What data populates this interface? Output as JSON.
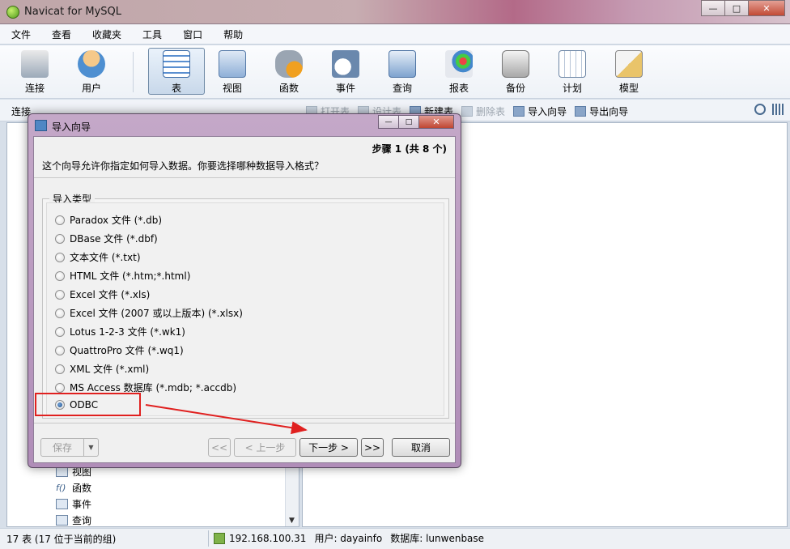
{
  "app": {
    "title": "Navicat for MySQL"
  },
  "window_controls": {
    "minimize": "—",
    "maximize": "□",
    "close": "✕"
  },
  "menu": [
    "文件",
    "查看",
    "收藏夹",
    "工具",
    "窗口",
    "帮助"
  ],
  "toolbar": [
    {
      "label": "连接",
      "icon": "connection-icon"
    },
    {
      "label": "用户",
      "icon": "user-icon"
    },
    {
      "label": "表",
      "icon": "table-icon"
    },
    {
      "label": "视图",
      "icon": "view-icon"
    },
    {
      "label": "函数",
      "icon": "function-icon"
    },
    {
      "label": "事件",
      "icon": "event-icon"
    },
    {
      "label": "查询",
      "icon": "query-icon"
    },
    {
      "label": "报表",
      "icon": "report-icon"
    },
    {
      "label": "备份",
      "icon": "backup-icon"
    },
    {
      "label": "计划",
      "icon": "schedule-icon"
    },
    {
      "label": "模型",
      "icon": "model-icon"
    }
  ],
  "subbar": {
    "conn_label": "连接",
    "actions": [
      {
        "label": "打开表",
        "disabled": true
      },
      {
        "label": "设计表",
        "disabled": true
      },
      {
        "label": "新建表",
        "disabled": false
      },
      {
        "label": "删除表",
        "disabled": true
      },
      {
        "label": "导入向导",
        "disabled": false
      },
      {
        "label": "导出向导",
        "disabled": false
      }
    ]
  },
  "tree": [
    {
      "label": "视图",
      "icon": "view-icon"
    },
    {
      "label": "函数",
      "icon": "function-icon"
    },
    {
      "label": "事件",
      "icon": "event-icon"
    },
    {
      "label": "查询",
      "icon": "query-icon"
    }
  ],
  "status": {
    "left": "17 表 (17 位于当前的组)",
    "host": "192.168.100.31",
    "user": "用户: dayainfo",
    "database": "数据库: lunwenbase"
  },
  "dialog": {
    "title": "导入向导",
    "step": "步骤 1 (共 8 个)",
    "description": "这个向导允许你指定如何导入数据。你要选择哪种数据导入格式？",
    "group_label": "导入类型",
    "options": [
      {
        "label": "Paradox 文件 (*.db)",
        "selected": false
      },
      {
        "label": "DBase 文件 (*.dbf)",
        "selected": false
      },
      {
        "label": "文本文件 (*.txt)",
        "selected": false
      },
      {
        "label": "HTML 文件 (*.htm;*.html)",
        "selected": false
      },
      {
        "label": "Excel 文件 (*.xls)",
        "selected": false
      },
      {
        "label": "Excel 文件 (2007 或以上版本) (*.xlsx)",
        "selected": false
      },
      {
        "label": "Lotus 1-2-3 文件 (*.wk1)",
        "selected": false
      },
      {
        "label": "QuattroPro 文件 (*.wq1)",
        "selected": false
      },
      {
        "label": "XML 文件 (*.xml)",
        "selected": false
      },
      {
        "label": "MS Access 数据库 (*.mdb; *.accdb)",
        "selected": false
      },
      {
        "label": "ODBC",
        "selected": true
      }
    ],
    "buttons": {
      "save": "保存",
      "first": "<<",
      "prev": "< 上一步",
      "next": "下一步 >",
      "last": ">>",
      "cancel": "取消"
    }
  },
  "colors": {
    "highlight": "#e0201f",
    "arrow": "#e0201f"
  }
}
